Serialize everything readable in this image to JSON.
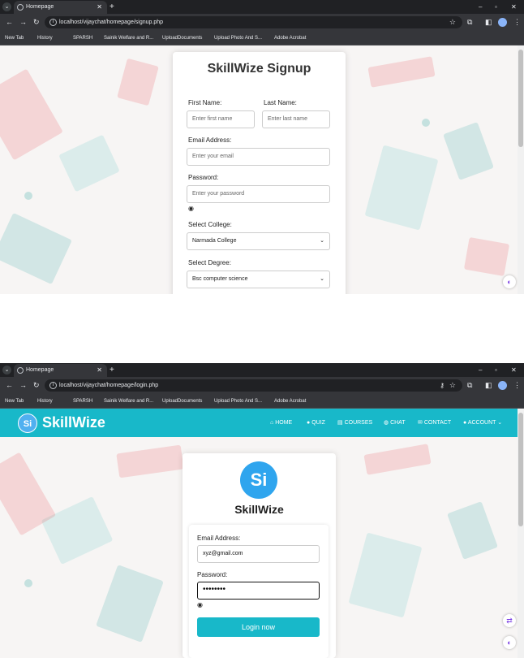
{
  "signup_window": {
    "tab_title": "Homepage",
    "url": "localhost/vijaychat/homepage/signup.php",
    "bookmarks": [
      "New Tab",
      "History",
      "SPARSH",
      "Sainik Welfare and R...",
      "UploadDocuments",
      "Upload Photo And S...",
      "Adobe Acrobat"
    ],
    "form": {
      "title": "SkillWize Signup",
      "first_name_label": "First Name:",
      "first_name_placeholder": "Enter first name",
      "last_name_label": "Last Name:",
      "last_name_placeholder": "Enter last name",
      "email_label": "Email Address:",
      "email_placeholder": "Enter your email",
      "password_label": "Password:",
      "password_placeholder": "Enter your password",
      "college_label": "Select College:",
      "college_value": "Narmada College",
      "degree_label": "Select Degree:",
      "degree_value": "Bsc computer science"
    }
  },
  "login_window": {
    "tab_title": "Homepage",
    "url": "localhost/vijaychat/homepage/login.php",
    "bookmarks": [
      "New Tab",
      "History",
      "SPARSH",
      "Sainik Welfare and R...",
      "UploadDocuments",
      "Upload Photo And S...",
      "Adobe Acrobat"
    ],
    "navbar": {
      "brand": "SkillWize",
      "logo_text": "Si",
      "items": [
        "HOME",
        "QUIZ",
        "COURSES",
        "CHAT",
        "CONTACT",
        "ACCOUNT"
      ]
    },
    "form": {
      "title": "SkillWize",
      "logo_text": "Si",
      "email_label": "Email Address:",
      "email_value": "xyz@gmail.com",
      "password_label": "Password:",
      "password_value": "••••••••",
      "button_label": "Login now"
    }
  },
  "colors": {
    "accent": "#18b8c9",
    "chrome_dark": "#202124",
    "page_bg": "#f7f5f4"
  }
}
